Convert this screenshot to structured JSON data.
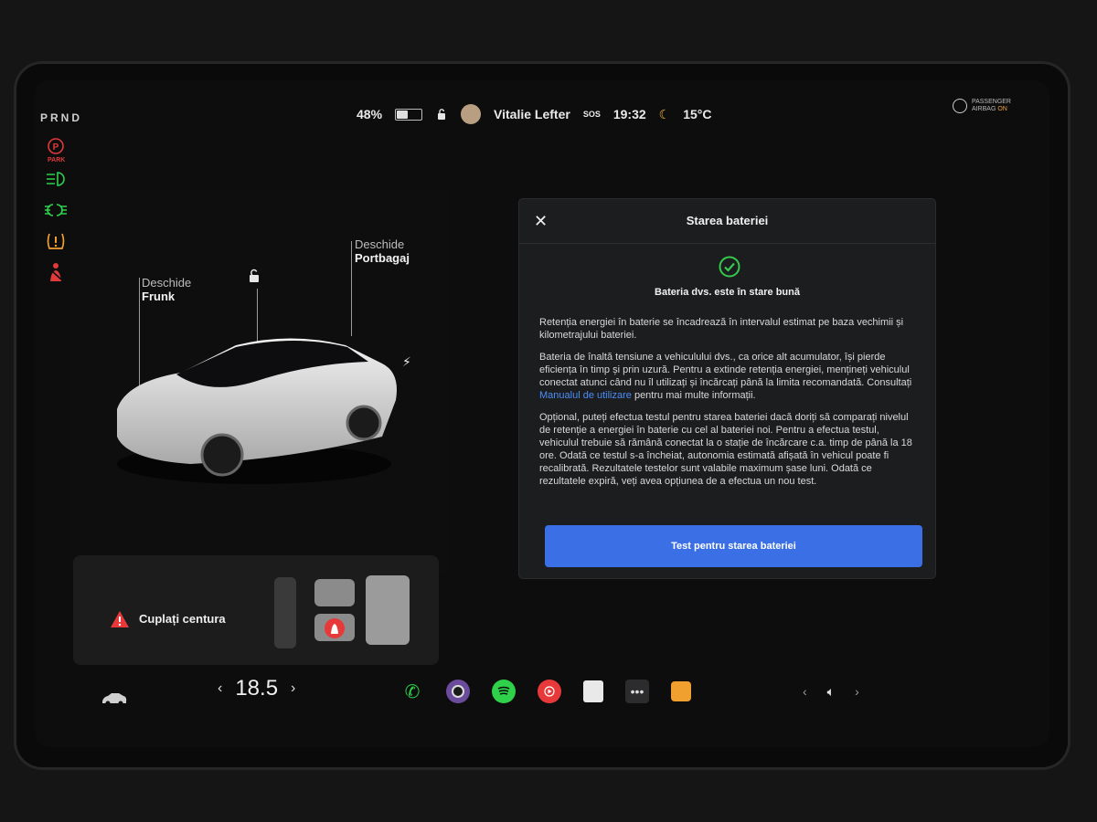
{
  "topbar": {
    "gear": "PRND",
    "park_label": "PARK",
    "battery_pct": "48%",
    "battery_level": 0.48,
    "user_name": "Vitalie Lefter",
    "sos": "SOS",
    "time": "19:32",
    "temperature": "15°C",
    "airbag": {
      "line1": "PASSENGER",
      "line2": "AIRBAG",
      "state": "ON"
    }
  },
  "car": {
    "frunk": {
      "action": "Deschide",
      "name": "Frunk"
    },
    "trunk": {
      "action": "Deschide",
      "name": "Portbagaj"
    }
  },
  "seatbelt": {
    "message": "Cuplați centura"
  },
  "bottombar": {
    "temp_value": "18.5",
    "temp_left": "‹",
    "temp_right": "›"
  },
  "modal": {
    "title": "Starea bateriei",
    "status": "Bateria dvs. este în stare bună",
    "p1": "Retenția energiei în baterie se încadrează în intervalul estimat pe baza vechimii și kilometrajului bateriei.",
    "p2_pre": "Bateria de înaltă tensiune a vehiculului dvs., ca orice alt acumulator, își pierde eficiența în timp și prin uzură. Pentru a extinde retenția energiei, mențineți vehiculul conectat atunci când nu îl utilizați și încărcați până la limita recomandată. Consultați ",
    "p2_link": "Manualul de utilizare",
    "p2_post": " pentru mai multe informații.",
    "p3": "Opțional, puteți efectua testul pentru starea bateriei dacă doriți să comparați nivelul de retenție a energiei în baterie cu cel al bateriei noi. Pentru a efectua testul, vehiculul trebuie să rămână conectat la o stație de încărcare c.a. timp de până la 18 ore. Odată ce testul s-a încheiat, autonomia estimată afișată în vehicul poate fi recalibrată. Rezultatele testelor sunt valabile maximum șase luni. Odată ce rezultatele expiră, veți avea opțiunea de a efectua un nou test.",
    "button": "Test pentru starea bateriei"
  },
  "colors": {
    "accent": "#3b6fe6",
    "ok": "#35c94f",
    "warn": "#e8393a"
  }
}
